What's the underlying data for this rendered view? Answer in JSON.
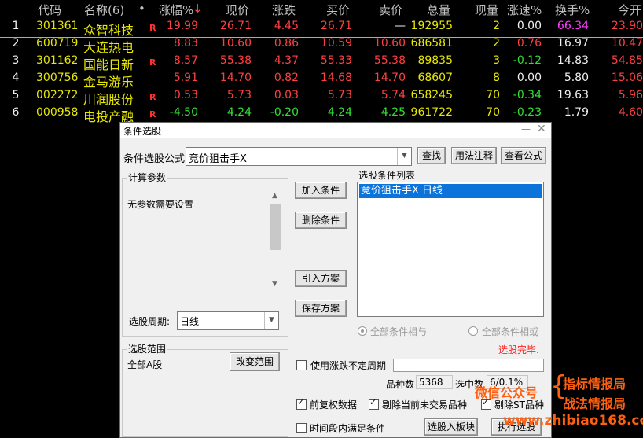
{
  "table": {
    "headers": {
      "code": "代码",
      "name": "名称(6)",
      "dot": "•",
      "pct": "涨幅%",
      "pct_sort": "↓",
      "price": "现价",
      "chg": "涨跌",
      "bid": "买价",
      "ask": "卖价",
      "vol": "总量",
      "cur": "现量",
      "speed": "涨速%",
      "turn": "换手%",
      "open": "今开"
    },
    "rows": [
      {
        "idx": "1",
        "code": "301361",
        "name": "众智科技",
        "flag": "R",
        "pct": "19.99",
        "price": "26.71",
        "chg": "4.45",
        "bid": "26.71",
        "ask": "—",
        "vol": "192955",
        "cur": "2",
        "speed": "0.00",
        "turn": "66.34",
        "open": "23.90"
      },
      {
        "idx": "2",
        "code": "600719",
        "name": "大连热电",
        "flag": "",
        "pct": "8.83",
        "price": "10.60",
        "chg": "0.86",
        "bid": "10.59",
        "ask": "10.60",
        "vol": "686581",
        "cur": "2",
        "speed": "0.76",
        "turn": "16.97",
        "open": "10.47"
      },
      {
        "idx": "3",
        "code": "301162",
        "name": "国能日新",
        "flag": "R",
        "pct": "8.57",
        "price": "55.38",
        "chg": "4.37",
        "bid": "55.33",
        "ask": "55.38",
        "vol": "89835",
        "cur": "3",
        "speed": "-0.12",
        "turn": "14.83",
        "open": "54.85"
      },
      {
        "idx": "4",
        "code": "300756",
        "name": "金马游乐",
        "flag": "",
        "pct": "5.91",
        "price": "14.70",
        "chg": "0.82",
        "bid": "14.68",
        "ask": "14.70",
        "vol": "68607",
        "cur": "8",
        "speed": "0.00",
        "turn": "5.80",
        "open": "15.06"
      },
      {
        "idx": "5",
        "code": "002272",
        "name": "川润股份",
        "flag": "R",
        "pct": "0.53",
        "price": "5.73",
        "chg": "0.03",
        "bid": "5.73",
        "ask": "5.74",
        "vol": "658245",
        "cur": "70",
        "speed": "-0.34",
        "turn": "19.63",
        "open": "5.96"
      },
      {
        "idx": "6",
        "code": "000958",
        "name": "电投产融",
        "flag": "R",
        "pct": "-4.50",
        "price": "4.24",
        "chg": "-0.20",
        "bid": "4.24",
        "ask": "4.25",
        "vol": "961722",
        "cur": "70",
        "speed": "-0.23",
        "turn": "1.79",
        "open": "4.60"
      }
    ]
  },
  "dialog": {
    "title": "条件选股",
    "formula_label": "条件选股公式",
    "formula_value": "竞价狙击手X",
    "btn_find": "查找",
    "btn_usage": "用法注释",
    "btn_view": "查看公式",
    "params_label": "计算参数",
    "params_text": "无参数需要设置",
    "btn_add": "加入条件",
    "btn_delete": "删除条件",
    "btn_import": "引入方案",
    "btn_save": "保存方案",
    "list_label": "选股条件列表",
    "list_item": "竞价狙击手X  日线",
    "period_label": "选股周期:",
    "period_value": "日线",
    "radio_and": "全部条件相与",
    "radio_or": "全部条件相或",
    "status": "选股完毕.",
    "range_label": "选股范围",
    "range_value": "全部A股",
    "btn_range": "改变范围",
    "chk_uncertain": "使用涨跌不定周期",
    "count_label": "品种数",
    "count_value": "5368",
    "hit_label": "选中数",
    "hit_value": "6/0.1%",
    "chk_fq": "前复权数据",
    "chk_notrade": "剔除当前未交易品种",
    "chk_st": "剔除ST品种",
    "chk_period": "时间段内满足条件",
    "btn_block": "选股入板块",
    "btn_exec": "执行选股"
  },
  "watermark": {
    "line1": "微信公众号",
    "line2": "指标情报局",
    "line3": "战法情报局",
    "url": "www.zhibiao168.com"
  },
  "colors": {
    "up": "#ff4040",
    "down": "#30e030",
    "code": "#e8e800",
    "accent": "#0b73d9"
  }
}
